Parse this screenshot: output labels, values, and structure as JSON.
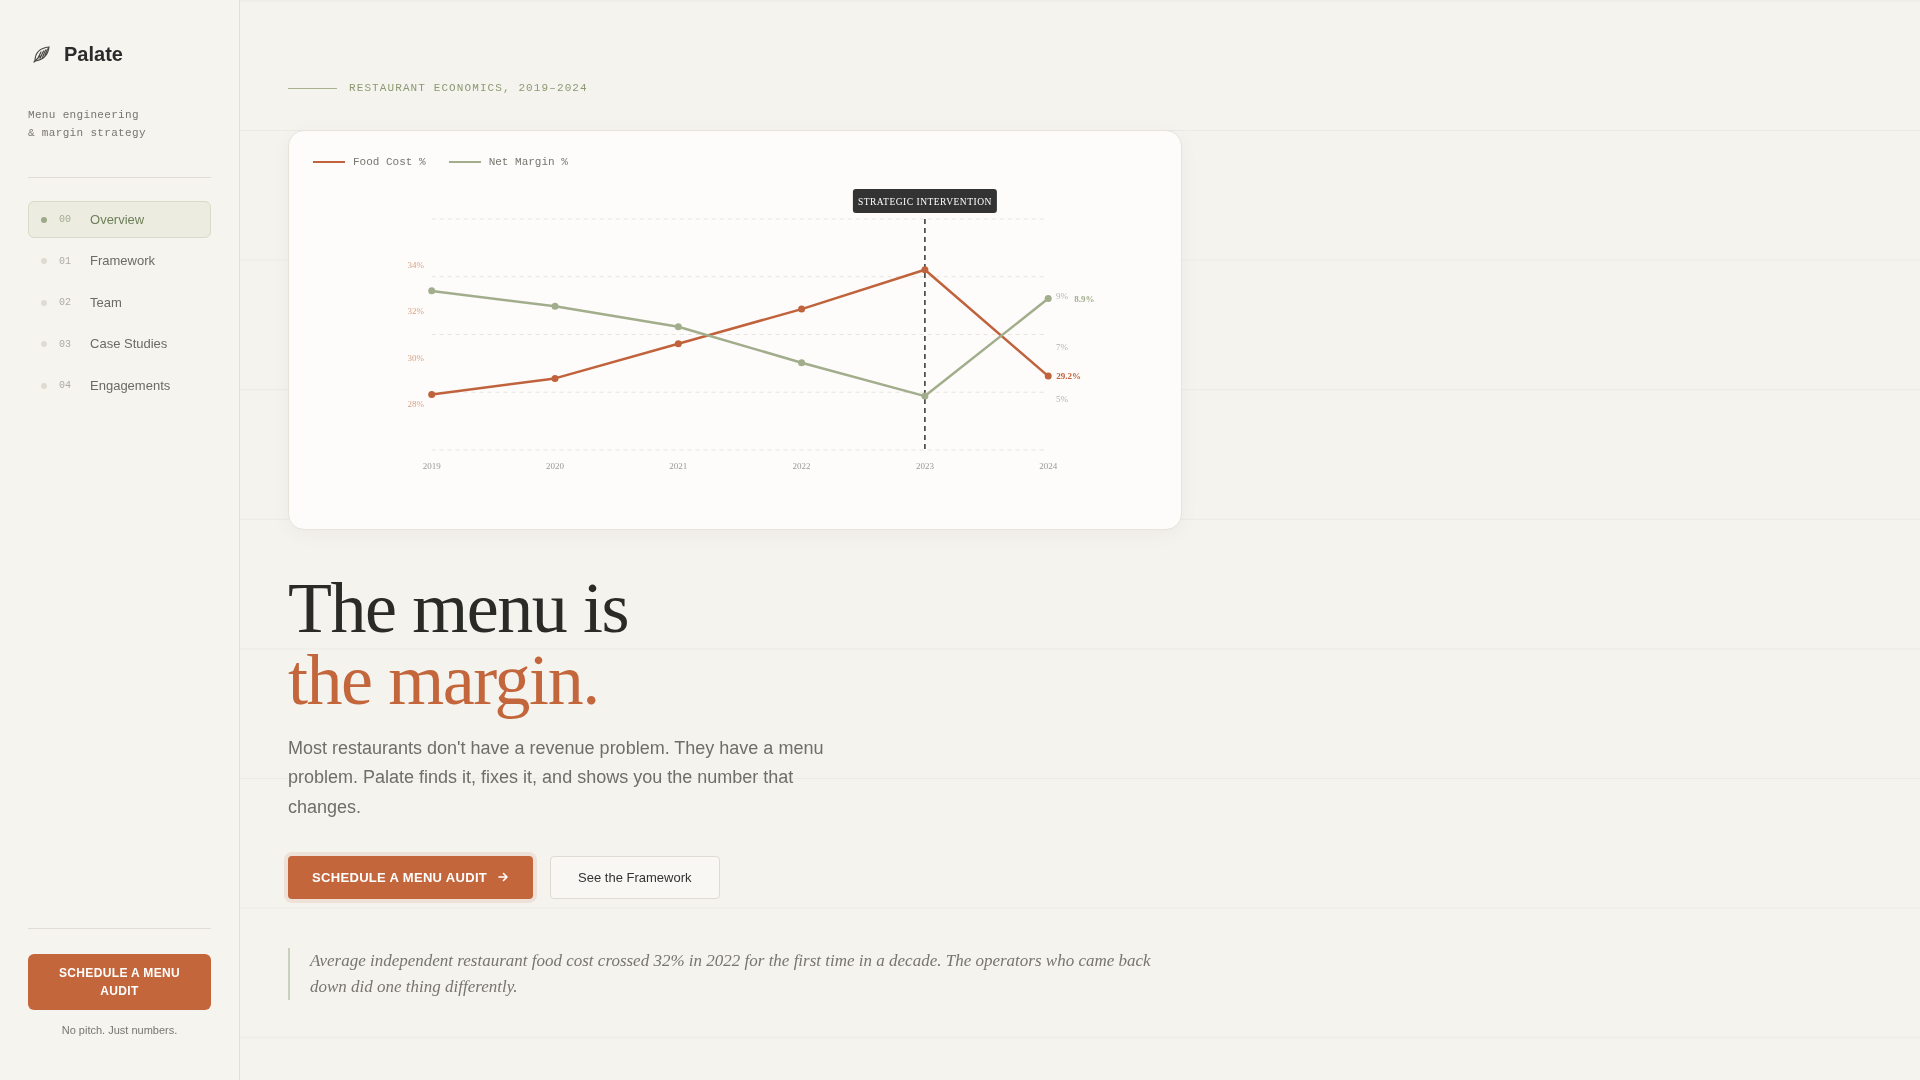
{
  "sidebar": {
    "brand": "Palate",
    "tagline": "Menu engineering\n& margin strategy",
    "items": [
      {
        "number": "00",
        "label": "Overview",
        "selected": true
      },
      {
        "number": "01",
        "label": "Framework",
        "selected": false
      },
      {
        "number": "02",
        "label": "Team",
        "selected": false
      },
      {
        "number": "03",
        "label": "Case Studies",
        "selected": false
      },
      {
        "number": "04",
        "label": "Engagements",
        "selected": false
      }
    ],
    "cta": "SCHEDULE A MENU AUDIT",
    "cta_note": "No pitch. Just numbers."
  },
  "main": {
    "eyebrow": "RESTAURANT ECONOMICS, 2019–2024",
    "chart_data": {
      "type": "line",
      "categories": [
        "2019",
        "2020",
        "2021",
        "2022",
        "2023",
        "2024"
      ],
      "series": [
        {
          "name": "Food Cost %",
          "color": "#c0623b",
          "values": [
            28.4,
            29.1,
            30.6,
            32.1,
            33.8,
            29.2
          ]
        },
        {
          "name": "Net Margin %",
          "color": "#a2ad8c",
          "axis": "y2",
          "values": [
            9.2,
            8.6,
            7.8,
            6.4,
            5.1,
            8.9
          ]
        }
      ],
      "ylim": [
        26,
        36
      ],
      "yticks": [
        {
          "value": 28,
          "label": "28%"
        },
        {
          "value": 30,
          "label": "30%"
        },
        {
          "value": 32,
          "label": "32%"
        },
        {
          "value": 34,
          "label": "34%"
        }
      ],
      "y2lim": [
        3,
        12
      ],
      "y2ticks": [
        {
          "value": 5,
          "label": "5%"
        },
        {
          "value": 7,
          "label": "7%"
        },
        {
          "value": 9,
          "label": "9%"
        }
      ],
      "grid": true,
      "legend": "top-left",
      "marker": "circle",
      "ref_lines": [
        {
          "axis": "x",
          "value": "2023",
          "label": "STRATEGIC INTERVENTION",
          "color": "#333333",
          "line_style": "dashed"
        }
      ],
      "annotations": [
        "29.2%",
        "8.9%"
      ]
    },
    "headline": "The menu is",
    "headline_accent": "the margin.",
    "lead": "Most restaurants don't have a revenue problem. They have a menu problem. Palate finds it, fixes it, and shows you the number that changes.",
    "buttons": [
      {
        "label": "SCHEDULE A MENU AUDIT",
        "kind": "primary"
      },
      {
        "label": "See the Framework",
        "kind": "secondary"
      }
    ],
    "quote": "Average independent restaurant food cost crossed 32% in 2022 for the first time in a decade. The operators who came back down did one thing differently."
  }
}
